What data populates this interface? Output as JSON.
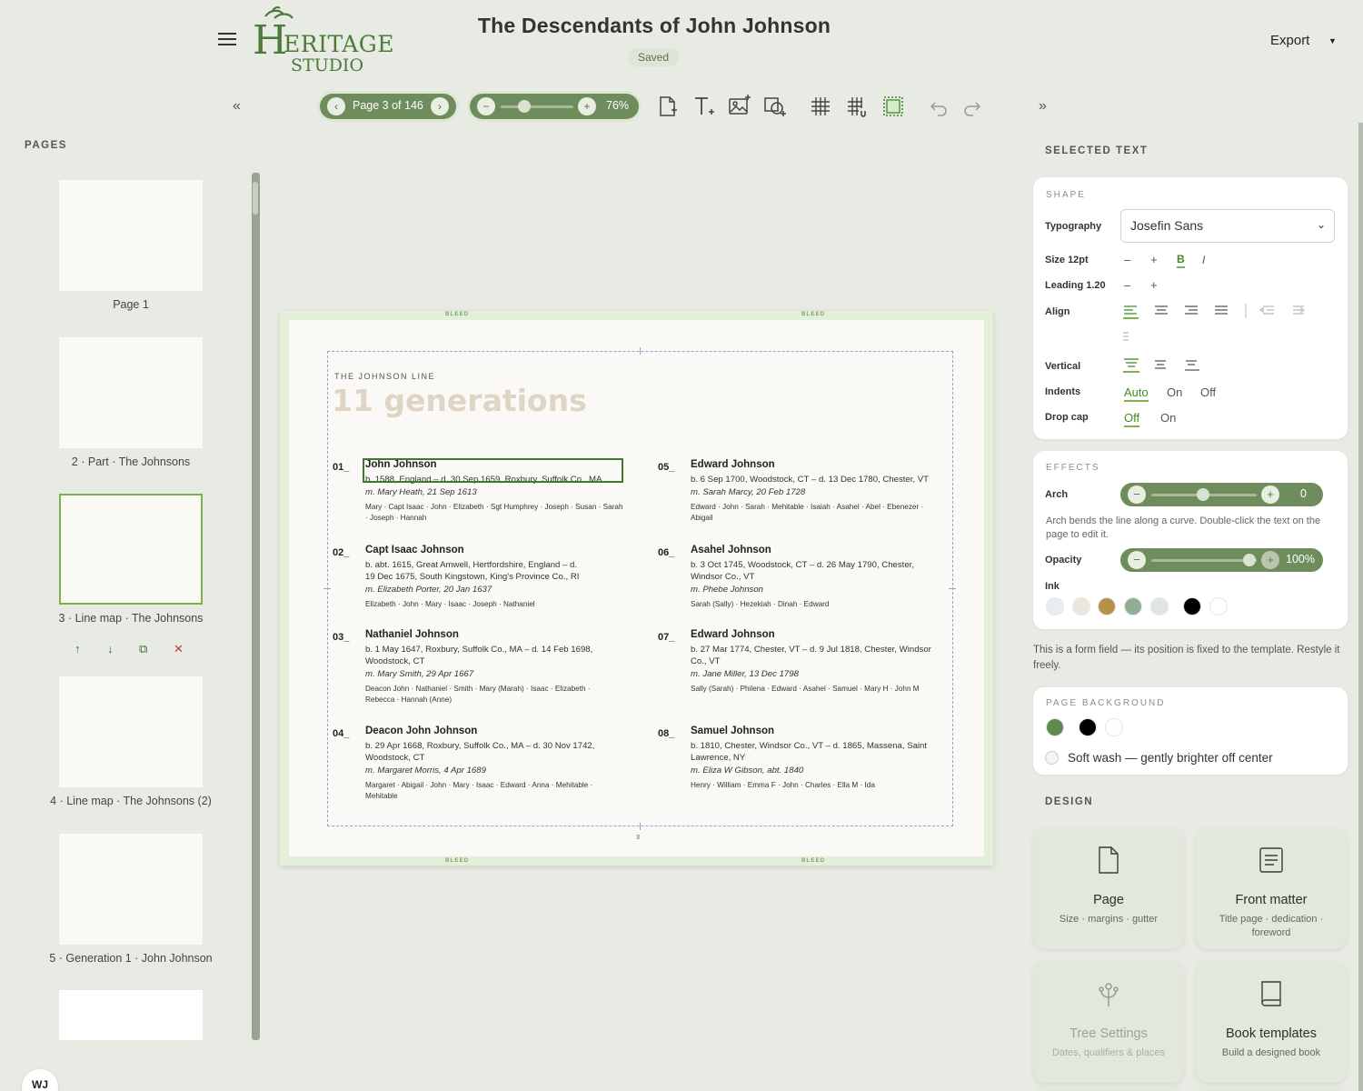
{
  "header": {
    "title": "The Descendants of John Johnson",
    "status": "Saved",
    "export_label": "Export",
    "logo_text_1": "ERITAGE",
    "logo_text_2": "STUDIO",
    "logo_initial": "H"
  },
  "toolbar": {
    "page_label": "Page 3 of 146",
    "zoom_value": "76%",
    "zoom_level": 0.76,
    "icons": [
      "add-page-icon",
      "add-text-icon",
      "add-image-icon",
      "add-shape-icon",
      "grid-icon",
      "snap-grid-icon",
      "bleed-toggle-icon",
      "undo-icon",
      "redo-icon"
    ]
  },
  "pages_panel": {
    "heading": "PAGES",
    "pages": [
      {
        "label": "Page 1"
      },
      {
        "label": "2 · Part · The Johnsons"
      },
      {
        "label": "3 · Line map · The Johnsons",
        "selected": true
      },
      {
        "label": "4 · Line map · The Johnsons (2)"
      },
      {
        "label": "5 · Generation 1 · John Johnson"
      }
    ],
    "actions": [
      "move-up-icon",
      "move-down-icon",
      "duplicate-icon",
      "delete-icon"
    ]
  },
  "user": {
    "initials": "WJ"
  },
  "canvas": {
    "bleed": "BLEED",
    "kicker": "THE JOHNSON LINE",
    "title": "11 generations",
    "page_number": "3",
    "generations": [
      {
        "num": "01_",
        "name": "John Johnson",
        "line1": "b. 1588, England – d. 30 Sep 1659, Roxbury, Suffolk Co., MA",
        "line2": "",
        "marriage": "m. Mary Heath, 21 Sep 1613",
        "kids1": "Mary · Capt Isaac · John · Elizabeth · Sgt Humphrey · Joseph · Susan · Sarah",
        "kids2": "· Joseph · Hannah"
      },
      {
        "num": "02_",
        "name": "Capt Isaac Johnson",
        "line1": "b. abt. 1615, Great Amwell, Hertfordshire, England – d.",
        "line2": "19 Dec 1675, South Kingstown, King's Province Co., RI",
        "marriage": "m. Elizabeth Porter, 20 Jan 1637",
        "kids1": "Elizabeth · John · Mary · Isaac · Joseph · Nathaniel",
        "kids2": ""
      },
      {
        "num": "03_",
        "name": "Nathaniel Johnson",
        "line1": "b. 1 May 1647, Roxbury, Suffolk Co., MA – d. 14 Feb 1698,",
        "line2": "Woodstock, CT",
        "marriage": "m. Mary Smith, 29 Apr 1667",
        "kids1": "Deacon John · Nathaniel · Smith · Mary (Marah) · Isaac · Elizabeth ·",
        "kids2": "Rebecca · Hannah (Anne)"
      },
      {
        "num": "04_",
        "name": "Deacon John Johnson",
        "line1": "b. 29 Apr 1668, Roxbury, Suffolk Co., MA – d. 30 Nov 1742,",
        "line2": "Woodstock, CT",
        "marriage": "m. Margaret Morris, 4 Apr 1689",
        "kids1": "Margaret · Abigail · John · Mary · Isaac · Edward · Anna · Mehitable ·",
        "kids2": "Mehitable"
      },
      {
        "num": "05_",
        "name": "Edward Johnson",
        "line1": "b. 6 Sep 1700, Woodstock, CT – d. 13 Dec 1780, Chester, VT",
        "line2": "",
        "marriage": "m. Sarah Marcy, 20 Feb 1728",
        "kids1": "Edward · John · Sarah · Mehitable · Isaiah · Asahel · Abel · Ebenezer ·",
        "kids2": "Abigail"
      },
      {
        "num": "06_",
        "name": "Asahel Johnson",
        "line1": "b. 3 Oct 1745, Woodstock, CT – d. 26 May 1790, Chester,",
        "line2": "Windsor Co., VT",
        "marriage": "m. Phebe Johnson",
        "kids1": "Sarah (Sally) · Hezekiah · Dinah · Edward",
        "kids2": ""
      },
      {
        "num": "07_",
        "name": "Edward Johnson",
        "line1": "b. 27 Mar 1774, Chester, VT – d. 9 Jul 1818, Chester, Windsor",
        "line2": "Co., VT",
        "marriage": "m. Jane Miller, 13 Dec 1798",
        "kids1": "Sally (Sarah) · Philena · Edward · Asahel · Samuel · Mary H · John M",
        "kids2": ""
      },
      {
        "num": "08_",
        "name": "Samuel Johnson",
        "line1": "b. 1810, Chester, Windsor Co., VT – d. 1865, Massena, Saint",
        "line2": "Lawrence, NY",
        "marriage": "m. Eliza W Gibson, abt. 1840",
        "kids1": "Henry · William · Emma F · John · Charles · Ella M · Ida",
        "kids2": ""
      }
    ]
  },
  "inspector": {
    "heading": "SELECTED TEXT",
    "shape": {
      "heading": "SHAPE",
      "typography_label": "Typography",
      "font_value": "Josefin Sans",
      "size_label": "Size 12pt",
      "leading_label": "Leading 1.20",
      "align_label": "Align",
      "vertical_label": "Vertical",
      "indents_label": "Indents",
      "indents_options": [
        "Auto",
        "On",
        "Off"
      ],
      "dropcap_label": "Drop cap",
      "dropcap_options": [
        "Off",
        "On"
      ],
      "minus": "–",
      "plus": "+",
      "bold": "B",
      "italic": "I"
    },
    "effects": {
      "heading": "EFFECTS",
      "arch_label": "Arch",
      "arch_value": "0",
      "arch_help": "Arch bends the line along a curve. Double-click the text on the page to edit it.",
      "opacity_label": "Opacity",
      "opacity_value": "100%",
      "ink_label": "Ink",
      "ink_colors": [
        "#e7eef3",
        "#ece7de",
        "#b79149",
        "#8fae92",
        "#dde6e1",
        "#000000",
        "#ffffff"
      ]
    },
    "form_note": "This is a form field — its position is fixed to the template. Restyle it freely.",
    "page_background": {
      "heading": "PAGE BACKGROUND",
      "colors": [
        "#5f8a4d",
        "#000000",
        "#ffffff"
      ],
      "wash_label": "Soft wash — gently brighter off center"
    },
    "design": {
      "heading": "DESIGN",
      "cards": [
        {
          "title": "Page",
          "sub": "Size · margins · gutter",
          "icon": "page-icon"
        },
        {
          "title": "Front matter",
          "sub": "Title page · dedication · foreword",
          "icon": "front-matter-icon"
        },
        {
          "title": "Tree Settings",
          "sub": "Dates, qualifiers & places",
          "icon": "tree-icon"
        },
        {
          "title": "Book templates",
          "sub": "Build a designed book",
          "icon": "book-icon"
        }
      ]
    }
  }
}
